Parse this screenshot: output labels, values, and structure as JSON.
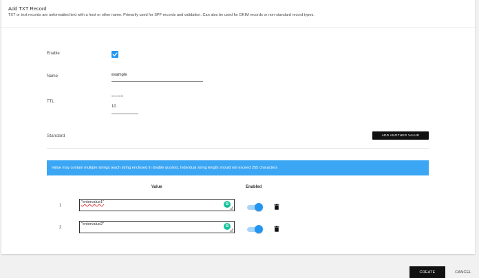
{
  "dialog": {
    "title": "Add TXT Record",
    "description": "TXT or text records are unformatted text with a host or other name. Primarily used for SPF records and validation. Can also be used for DKIM records or non-standard record types."
  },
  "form": {
    "enable_label": "Enable",
    "enable_checked": true,
    "name_label": "Name",
    "name_value": "example",
    "ttl_label": "TTL",
    "ttl_unit": "seconds",
    "ttl_value": "10"
  },
  "standard": {
    "label": "Standard",
    "add_button": "ADD ANOTHER VALUE",
    "info": "Value may contain multiple strings (each string enclosed in double quotes). Individual string length should not exceed 255 characters",
    "columns": {
      "value": "Value",
      "enabled": "Enabled"
    },
    "rows": [
      {
        "num": "1",
        "value": "\"entervalue1\"",
        "enabled": true
      },
      {
        "num": "2",
        "value": "\"entervalue2\"",
        "enabled": true
      }
    ]
  },
  "footer": {
    "create": "CREATE",
    "cancel": "CANCEL"
  },
  "colors": {
    "accent": "#2196f3",
    "info_bg": "#3aa6f4",
    "button_dark": "#111111",
    "grammarly": "#15c39a"
  },
  "icons": [
    "check-icon",
    "grammarly-icon",
    "resize-handle-icon",
    "trash-icon"
  ]
}
